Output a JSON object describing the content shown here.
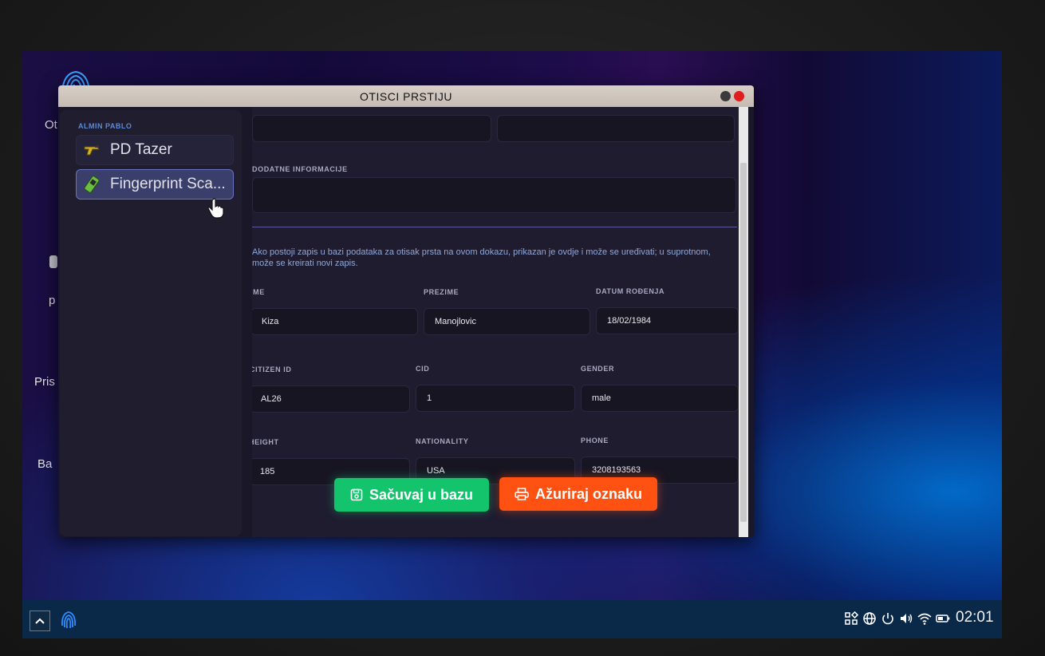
{
  "window": {
    "title": "OTISCI PRSTIJU"
  },
  "desktop": {
    "icons": [
      {
        "label": "Ot"
      },
      {
        "label": "p"
      },
      {
        "label": "Pris"
      },
      {
        "label": "Ba"
      }
    ]
  },
  "sidebar": {
    "user": "ALMIN PABLO",
    "items": [
      {
        "label": "PD Tazer",
        "icon": "taser-icon"
      },
      {
        "label": "Fingerprint Sca...",
        "icon": "fingerprint-scanner-icon"
      }
    ]
  },
  "form": {
    "additional_info_label": "DODATNE INFORMACIJE",
    "additional_info_value": "",
    "top_field_1": "",
    "top_field_2": "",
    "info_text": "Ako postoji zapis u bazi podataka za otisak prsta na ovom dokazu, prikazan je ovdje i može se uređivati; u suprotnom, može se kreirati novi zapis.",
    "fields": {
      "ime": {
        "label": "IME",
        "value": "Kiza"
      },
      "prezime": {
        "label": "PREZIME",
        "value": "Manojlovic"
      },
      "datum": {
        "label": "DATUM ROĐENJA",
        "value": "18/02/1984"
      },
      "citizen_id": {
        "label": "CITIZEN ID",
        "value": "AL26"
      },
      "cid": {
        "label": "CID",
        "value": "1"
      },
      "gender": {
        "label": "GENDER",
        "value": "male"
      },
      "height": {
        "label": "HEIGHT",
        "value": "185"
      },
      "nationality": {
        "label": "NATIONALITY",
        "value": "USA"
      },
      "phone": {
        "label": "PHONE",
        "value": "3208193563"
      }
    }
  },
  "buttons": {
    "save": "Sačuvaj u bazu",
    "update": "Ažuriraj oznaku"
  },
  "taskbar": {
    "clock": "02:01"
  },
  "colors": {
    "save": "#13c46c",
    "update": "#ff5212",
    "accent": "#6a72c4"
  }
}
